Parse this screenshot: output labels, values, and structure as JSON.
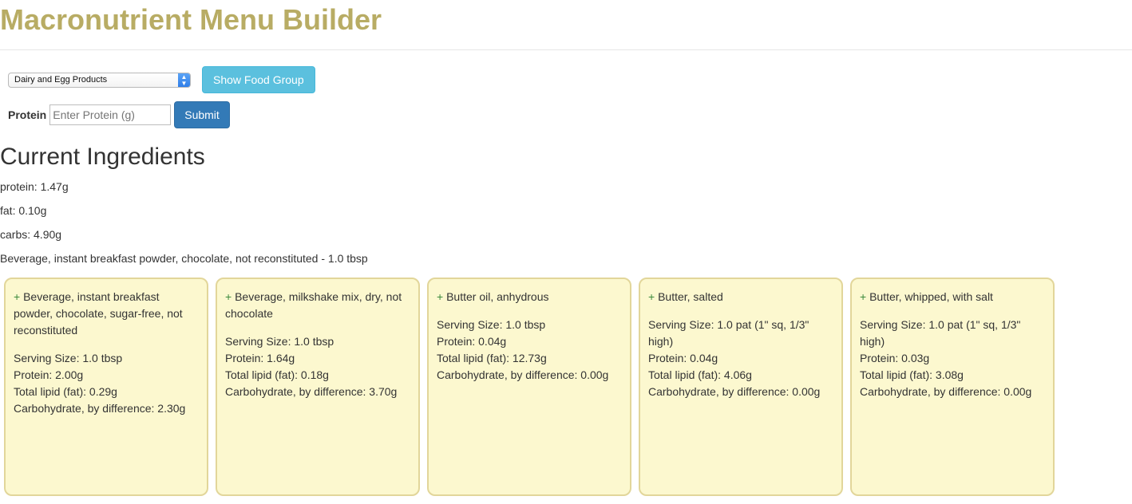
{
  "app": {
    "title": "Macronutrient Menu Builder"
  },
  "controls": {
    "food_group_selected": "Dairy and Egg Products",
    "show_button": "Show Food Group",
    "protein_label": "Protein",
    "protein_placeholder": "Enter Protein (g)",
    "submit_button": "Submit"
  },
  "current": {
    "heading": "Current Ingredients",
    "protein": "protein: 1.47g",
    "fat": "fat: 0.10g",
    "carbs": "carbs: 4.90g",
    "ingredient": "Beverage, instant breakfast powder, chocolate, not reconstituted - 1.0 tbsp"
  },
  "foods": [
    {
      "name": "Beverage, instant breakfast powder, chocolate, sugar-free, not reconstituted",
      "serving": "Serving Size: 1.0 tbsp",
      "protein": "Protein: 2.00g",
      "fat": "Total lipid (fat): 0.29g",
      "carbs": "Carbohydrate, by difference: 2.30g"
    },
    {
      "name": "Beverage, milkshake mix, dry, not chocolate",
      "serving": "Serving Size: 1.0 tbsp",
      "protein": "Protein: 1.64g",
      "fat": "Total lipid (fat): 0.18g",
      "carbs": "Carbohydrate, by difference: 3.70g"
    },
    {
      "name": "Butter oil, anhydrous",
      "serving": "Serving Size: 1.0 tbsp",
      "protein": "Protein: 0.04g",
      "fat": "Total lipid (fat): 12.73g",
      "carbs": "Carbohydrate, by difference: 0.00g"
    },
    {
      "name": "Butter, salted",
      "serving": "Serving Size: 1.0 pat (1\" sq, 1/3\" high)",
      "protein": "Protein: 0.04g",
      "fat": "Total lipid (fat): 4.06g",
      "carbs": "Carbohydrate, by difference: 0.00g"
    },
    {
      "name": "Butter, whipped, with salt",
      "serving": "Serving Size: 1.0 pat (1\" sq, 1/3\" high)",
      "protein": "Protein: 0.03g",
      "fat": "Total lipid (fat): 3.08g",
      "carbs": "Carbohydrate, by difference: 0.00g"
    }
  ],
  "icons": {
    "add": "+",
    "select_arrows": "up-down-chevron-icon"
  }
}
